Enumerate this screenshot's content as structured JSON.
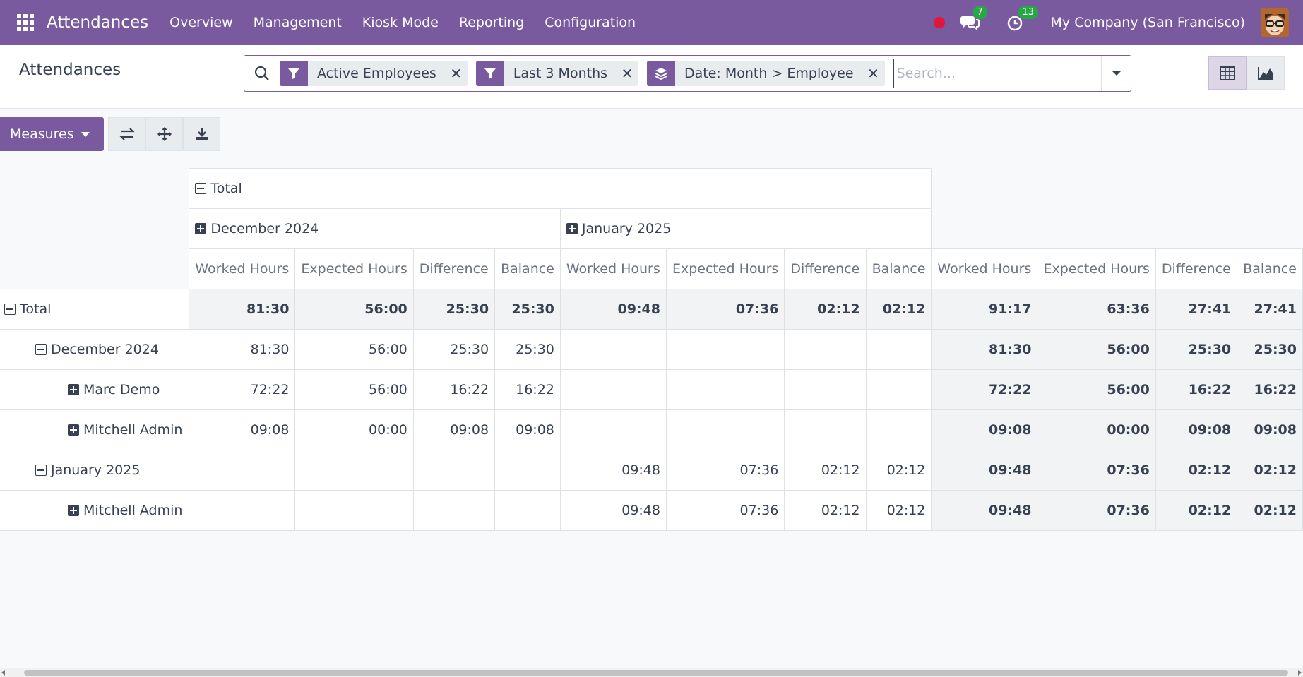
{
  "navbar": {
    "app_title": "Attendances",
    "menu": [
      "Overview",
      "Management",
      "Kiosk Mode",
      "Reporting",
      "Configuration"
    ],
    "messages_count": "7",
    "activities_count": "13",
    "company": "My Company (San Francisco)"
  },
  "control_panel": {
    "title": "Attendances",
    "facets": [
      {
        "type": "filter",
        "label": "Active Employees"
      },
      {
        "type": "filter",
        "label": "Last 3 Months"
      },
      {
        "type": "groupby",
        "label": "Date: Month > Employee"
      }
    ],
    "search_placeholder": "Search..."
  },
  "toolbar": {
    "measures_label": "Measures"
  },
  "pivot": {
    "col_total_label": "Total",
    "col_groups": [
      "December 2024",
      "January 2025"
    ],
    "measures": [
      "Worked Hours",
      "Expected Hours",
      "Difference",
      "Balance"
    ],
    "rows": [
      {
        "label": "Total",
        "level": 0,
        "icon": "minus",
        "dec": [
          "81:30",
          "56:00",
          "25:30",
          "25:30"
        ],
        "jan": [
          "09:48",
          "07:36",
          "02:12",
          "02:12"
        ],
        "total": [
          "91:17",
          "63:36",
          "27:41",
          "27:41"
        ]
      },
      {
        "label": "December 2024",
        "level": 1,
        "icon": "minus",
        "dec": [
          "81:30",
          "56:00",
          "25:30",
          "25:30"
        ],
        "jan": [
          "",
          "",
          "",
          ""
        ],
        "total": [
          "81:30",
          "56:00",
          "25:30",
          "25:30"
        ]
      },
      {
        "label": "Marc Demo",
        "level": 2,
        "icon": "plus",
        "dec": [
          "72:22",
          "56:00",
          "16:22",
          "16:22"
        ],
        "jan": [
          "",
          "",
          "",
          ""
        ],
        "total": [
          "72:22",
          "56:00",
          "16:22",
          "16:22"
        ]
      },
      {
        "label": "Mitchell Admin",
        "level": 2,
        "icon": "plus",
        "dec": [
          "09:08",
          "00:00",
          "09:08",
          "09:08"
        ],
        "jan": [
          "",
          "",
          "",
          ""
        ],
        "total": [
          "09:08",
          "00:00",
          "09:08",
          "09:08"
        ]
      },
      {
        "label": "January 2025",
        "level": 1,
        "icon": "minus",
        "dec": [
          "",
          "",
          "",
          ""
        ],
        "jan": [
          "09:48",
          "07:36",
          "02:12",
          "02:12"
        ],
        "total": [
          "09:48",
          "07:36",
          "02:12",
          "02:12"
        ]
      },
      {
        "label": "Mitchell Admin",
        "level": 2,
        "icon": "plus",
        "dec": [
          "",
          "",
          "",
          ""
        ],
        "jan": [
          "09:48",
          "07:36",
          "02:12",
          "02:12"
        ],
        "total": [
          "09:48",
          "07:36",
          "02:12",
          "02:12"
        ]
      }
    ]
  }
}
